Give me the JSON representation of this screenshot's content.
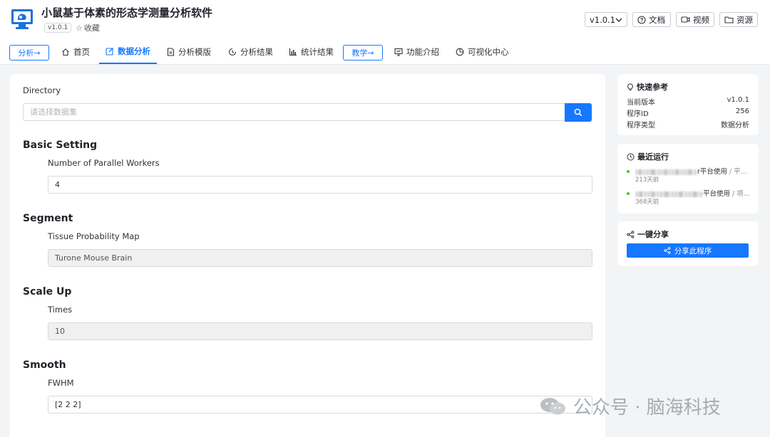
{
  "app": {
    "title": "小鼠基于体素的形态学测量分析软件",
    "version_badge": "v1.0.1",
    "favorite_label": "收藏",
    "icon": "monitor-app-icon"
  },
  "header_actions": {
    "version_select": "v1.0.1",
    "docs": "文档",
    "video": "视频",
    "resources": "资源"
  },
  "nav": {
    "analysis_pill": "分析→",
    "home": "首页",
    "data_analysis": "数据分析",
    "analysis_template": "分析模版",
    "analysis_results": "分析结果",
    "stats_results": "统计结果",
    "teaching_pill": "教学→",
    "feature_intro": "功能介绍",
    "viz_center": "可视化中心",
    "active": "数据分析"
  },
  "form": {
    "directory_label": "Directory",
    "directory_placeholder": "请选择数据集",
    "sections": [
      {
        "title": "Basic Setting",
        "label": "Number of Parallel Workers",
        "value": "4",
        "disabled": false
      },
      {
        "title": "Segment",
        "label": "Tissue Probability Map",
        "value": "Turone Mouse Brain",
        "disabled": true
      },
      {
        "title": "Scale Up",
        "label": "Times",
        "value": "10",
        "disabled": true
      },
      {
        "title": "Smooth",
        "label": "FWHM",
        "value": "[2 2 2]",
        "disabled": false
      }
    ]
  },
  "quick_ref": {
    "title": "快速参考",
    "rows": [
      {
        "key": "当前版本",
        "value": "v1.0.1"
      },
      {
        "key": "程序ID",
        "value": "256"
      },
      {
        "key": "程序类型",
        "value": "数据分析"
      }
    ]
  },
  "recent_runs": {
    "title": "最近运行",
    "items": [
      {
        "text": "r平台使用",
        "suffix": " / 平...",
        "time": "213天前"
      },
      {
        "text": "平台使用",
        "suffix": " / 项...",
        "time": "368天前"
      }
    ]
  },
  "share": {
    "title": "一键分享",
    "button": "分享此程序"
  },
  "watermark": {
    "text": "公众号 · 脑海科技"
  },
  "colors": {
    "accent": "#1677ff",
    "status_ok": "#52c41a",
    "background": "#f3f4f6"
  }
}
